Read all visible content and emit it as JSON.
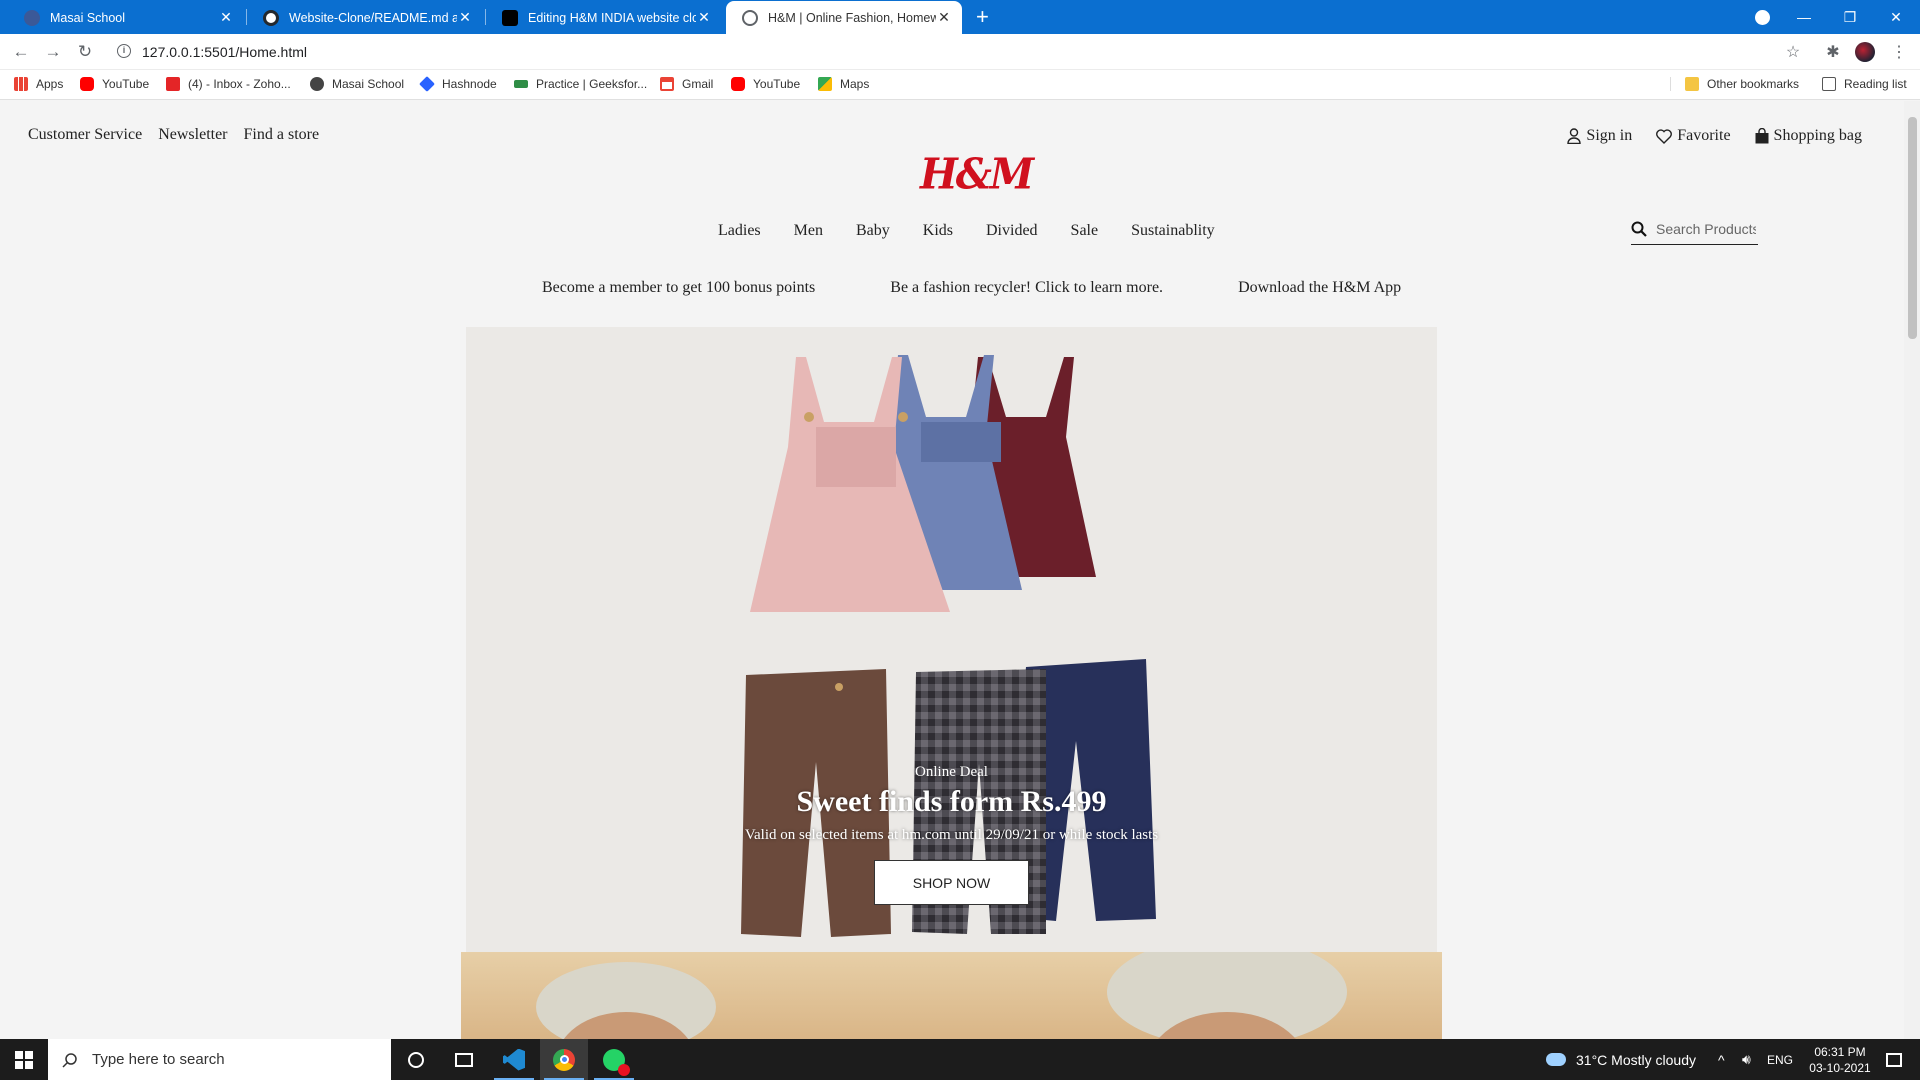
{
  "browser": {
    "tabs": [
      {
        "title": "Masai School",
        "active": false
      },
      {
        "title": "Website-Clone/README.md at m",
        "active": false
      },
      {
        "title": "Editing H&M INDIA website clon",
        "active": false
      },
      {
        "title": "H&M | Online Fashion, Homewar",
        "active": true
      }
    ],
    "url": "127.0.0.1:5501/Home.html",
    "bookmarks": [
      "Apps",
      "YouTube",
      "(4) - Inbox - Zoho...",
      "Masai School",
      "Hashnode",
      "Practice | Geeksfor...",
      "Gmail",
      "YouTube",
      "Maps"
    ],
    "other_bookmarks": "Other bookmarks",
    "reading_list": "Reading list"
  },
  "site": {
    "top_links": [
      "Customer Service",
      "Newsletter",
      "Find a store"
    ],
    "account": {
      "sign_in": "Sign in",
      "favorite": "Favorite",
      "bag": "Shopping bag"
    },
    "logo": "H&M",
    "nav": [
      "Ladies",
      "Men",
      "Baby",
      "Kids",
      "Divided",
      "Sale",
      "Sustainablity"
    ],
    "search_placeholder": "Search Products",
    "promos": [
      "Become a member to get 100 bonus points",
      "Be a fashion recycler! Click to learn more.",
      "Download the H&M App"
    ],
    "hero": {
      "kicker": "Online Deal",
      "title": "Sweet finds form Rs.499",
      "subtitle": "Valid on selected items at hm.com until 29/09/21 or while stock lasts",
      "cta": "SHOP NOW"
    }
  },
  "taskbar": {
    "search_placeholder": "Type here to search",
    "weather": "31°C  Mostly cloudy",
    "lang": "ENG",
    "time": "06:31 PM",
    "date": "03-10-2021"
  }
}
